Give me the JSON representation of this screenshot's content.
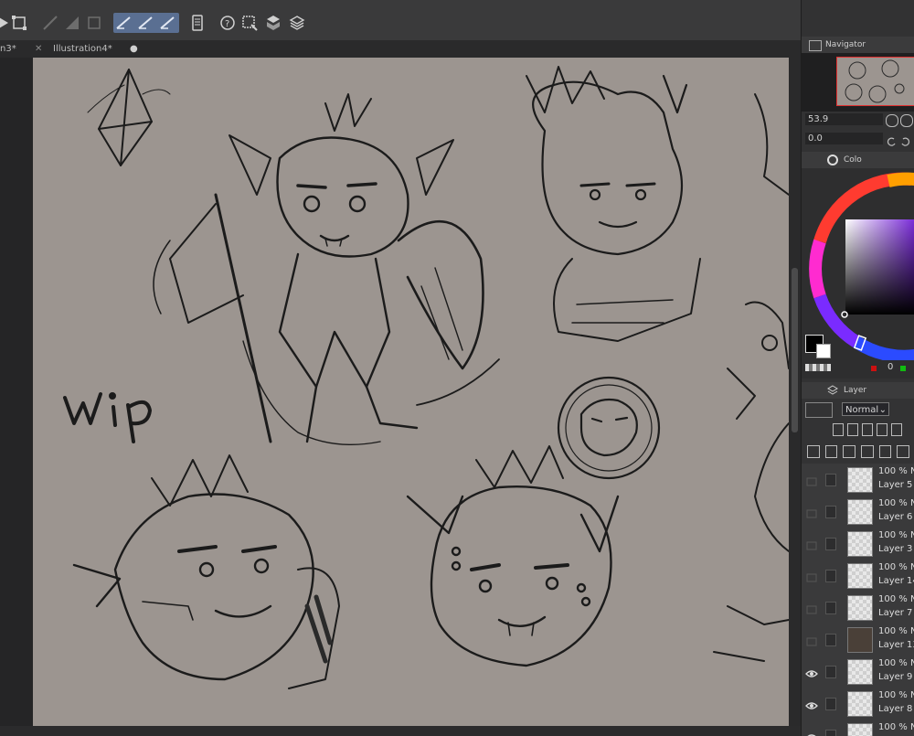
{
  "tabs": [
    {
      "label": "n3*"
    },
    {
      "label": "Illustration4*"
    }
  ],
  "toolbar": {
    "icons": [
      "play-icon",
      "transform-icon",
      "ruler-icon",
      "fill-icon",
      "frame-icon",
      "pen-stroke-icon",
      "pen-stroke-2-icon",
      "pen-stroke-3-icon",
      "device-icon",
      "assist-icon",
      "select-layer-icon",
      "material-icon",
      "layers-stack-icon"
    ]
  },
  "canvas": {
    "text": "wip"
  },
  "navigator": {
    "title": "Navigator",
    "zoom_value": "53.9",
    "rotation_value": "0.0"
  },
  "color_panel": {
    "title": "Colo",
    "main_color": "#000000",
    "sub_color": "#ffffff",
    "count_value": "0"
  },
  "layer_panel": {
    "title": "Layer",
    "blend_mode": "Normal",
    "layers": [
      {
        "opacity": "100 % N",
        "name": "Layer 5",
        "visible": false
      },
      {
        "opacity": "100 % N",
        "name": "Layer 6",
        "visible": false
      },
      {
        "opacity": "100 % N",
        "name": "Layer 3",
        "visible": false
      },
      {
        "opacity": "100 % N",
        "name": "Layer 14",
        "visible": false
      },
      {
        "opacity": "100 % N",
        "name": "Layer 7",
        "visible": false
      },
      {
        "opacity": "100 % N",
        "name": "Layer 13",
        "visible": false
      },
      {
        "opacity": "100 % N",
        "name": "Layer 9",
        "visible": true
      },
      {
        "opacity": "100 % N",
        "name": "Layer 8",
        "visible": true
      },
      {
        "opacity": "100 % N",
        "name": "",
        "visible": true
      }
    ]
  },
  "colors": {
    "accent": "#5a6f92",
    "canvas_bg": "#9c9590",
    "nav_frame": "#e03030"
  }
}
